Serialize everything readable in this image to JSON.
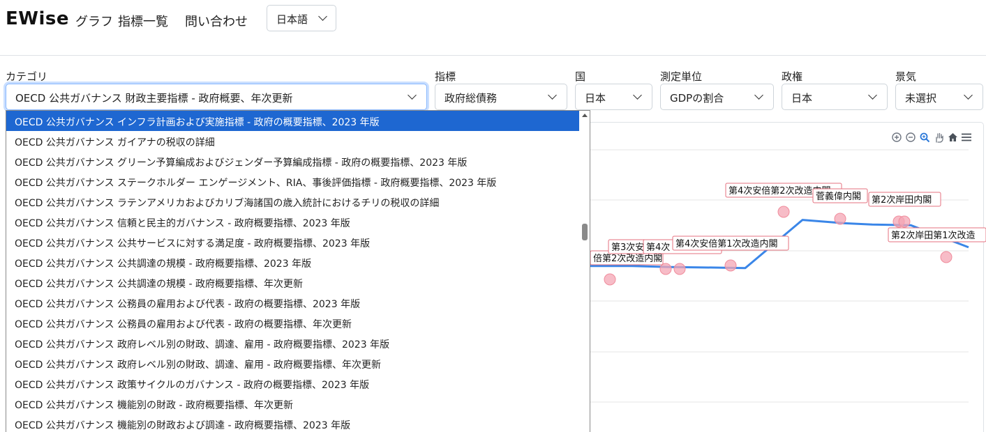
{
  "navbar": {
    "brand": "EWise",
    "links": [
      "グラフ",
      "指標一覧",
      "問い合わせ"
    ],
    "language": "日本語"
  },
  "filters": {
    "category": {
      "label": "カテゴリ",
      "value": "OECD 公共ガバナンス 財政主要指標 - 政府概要、年次更新"
    },
    "indicator": {
      "label": "指標",
      "value": "政府総債務"
    },
    "country": {
      "label": "国",
      "value": "日本"
    },
    "unit": {
      "label": "測定単位",
      "value": "GDPの割合"
    },
    "regime": {
      "label": "政権",
      "value": "日本"
    },
    "economy": {
      "label": "景気",
      "value": "未選択"
    }
  },
  "dropdown": {
    "options": [
      "OECD 公共ガバナンス インフラ計画および実施指標 - 政府の概要指標、2023 年版",
      "OECD 公共ガバナンス ガイアナの税収の詳細",
      "OECD 公共ガバナンス グリーン予算編成およびジェンダー予算編成指標 - 政府の概要指標、2023 年版",
      "OECD 公共ガバナンス ステークホルダー エンゲージメント、RIA、事後評価指標 - 政府概要指標、2023 年版",
      "OECD 公共ガバナンス ラテンアメリカおよびカリブ海諸国の歳入統計におけるチリの税収の詳細",
      "OECD 公共ガバナンス 信頼と民主的ガバナンス - 政府概要指標、2023 年版",
      "OECD 公共ガバナンス 公共サービスに対する満足度 - 政府概要指標、2023 年版",
      "OECD 公共ガバナンス 公共調達の規模 - 政府概要指標、2023 年版",
      "OECD 公共ガバナンス 公共調達の規模 - 政府概要指標、年次更新",
      "OECD 公共ガバナンス 公務員の雇用および代表 - 政府の概要指標、2023 年版",
      "OECD 公共ガバナンス 公務員の雇用および代表 - 政府の概要指標、年次更新",
      "OECD 公共ガバナンス 政府レベル別の財政、調達、雇用 - 政府概要指標、2023 年版",
      "OECD 公共ガバナンス 政府レベル別の財政、調達、雇用 - 政府概要指標、年次更新",
      "OECD 公共ガバナンス 政策サイクルのガバナンス - 政府の概要指標、2023 年版",
      "OECD 公共ガバナンス 機能別の財政 - 政府概要指標、年次更新",
      "OECD 公共ガバナンス 機能別の財政および調達 - 政府概要指標、2023 年版"
    ],
    "selected_index": 0
  },
  "chart_data": {
    "type": "line",
    "series": [
      {
        "values": [
          0.2,
          0.2,
          0.185,
          0.18,
          0.17,
          0.89,
          0.84,
          0.82,
          0.81,
          0.48
        ]
      }
    ],
    "annotations": [
      "倍第2次改造内閣",
      "第3次安",
      "第4次",
      "第4次安倍第1次改造内閣",
      "第4次安倍第2次改造内閣",
      "菅義偉内閣",
      "第2次岸田内閣",
      "第2次岸田第1次改造"
    ],
    "colors": {
      "line": "#3a86e8",
      "marker": "#f4a6b4",
      "label_border": "#e5717f"
    }
  },
  "toolbar": {
    "icons": [
      "zoom-in-icon",
      "zoom-out-icon",
      "zoom-select-icon",
      "pan-icon",
      "home-icon",
      "menu-icon"
    ]
  }
}
